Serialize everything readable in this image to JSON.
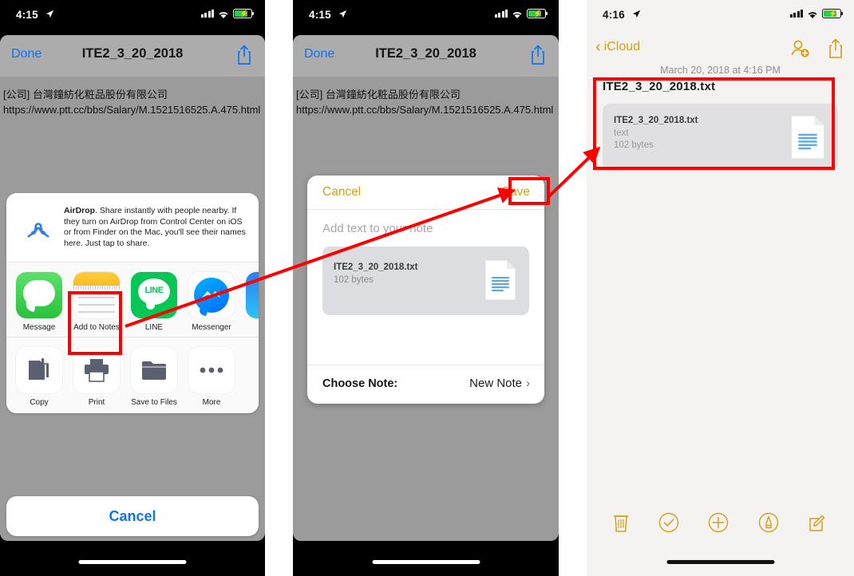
{
  "panels": [
    {
      "id": "share-sheet",
      "statusbar": {
        "time": "4:15",
        "location_icon": "location-arrow-icon",
        "signal": "cellular-bars-icon",
        "wifi": "wifi-icon",
        "battery": "battery-charging-icon"
      },
      "navbar": {
        "done": "Done",
        "title": "ITE2_3_20_2018",
        "share_icon": "share-icon"
      },
      "document": {
        "line1": "[公司] 台灣鐘紡化粧品股份有限公司",
        "line2": "https://www.ptt.cc/bbs/Salary/M.1521516525.A.475.html"
      },
      "airdrop": {
        "icon": "airdrop-icon",
        "bold": "AirDrop",
        "text": ". Share instantly with people nearby. If they turn on AirDrop from Control Center on iOS or from Finder on the Mac, you'll see their names here. Just tap to share."
      },
      "apps": [
        {
          "label": "Message",
          "icon": "messages-app-icon"
        },
        {
          "label": "Add to Notes",
          "icon": "notes-app-icon",
          "highlighted": true
        },
        {
          "label": "LINE",
          "icon": "line-app-icon"
        },
        {
          "label": "Messenger",
          "icon": "messenger-app-icon"
        },
        {
          "label": "",
          "icon": "telegram-app-icon"
        }
      ],
      "actions": [
        {
          "label": "Copy",
          "icon": "copy-icon"
        },
        {
          "label": "Print",
          "icon": "printer-icon"
        },
        {
          "label": "Save to Files",
          "icon": "folder-icon"
        },
        {
          "label": "More",
          "icon": "more-ellipsis-icon"
        }
      ],
      "cancel": "Cancel"
    },
    {
      "id": "add-to-notes",
      "statusbar": {
        "time": "4:15"
      },
      "navbar": {
        "done": "Done",
        "title": "ITE2_3_20_2018",
        "share_icon": "share-icon"
      },
      "document": {
        "line1": "[公司] 台灣鐘紡化粧品股份有限公司",
        "line2": "https://www.ptt.cc/bbs/Salary/M.1521516525.A.475.html"
      },
      "notes_sheet": {
        "cancel": "Cancel",
        "save": "Save",
        "placeholder": "Add text to your note",
        "attachment": {
          "name": "ITE2_3_20_2018.txt",
          "size": "102 bytes",
          "icon": "text-file-icon"
        },
        "choose_label": "Choose Note:",
        "choose_value": "New Note",
        "chevron": "chevron-right-icon"
      }
    },
    {
      "id": "notes-saved",
      "statusbar": {
        "time": "4:16"
      },
      "navbar": {
        "back": "iCloud",
        "back_icon": "chevron-left-icon",
        "add_people_icon": "add-person-icon",
        "share_icon": "share-icon"
      },
      "date": "March 20, 2018 at 4:16 PM",
      "note": {
        "title": "ITE2_3_20_2018.txt",
        "attachment": {
          "name": "ITE2_3_20_2018.txt",
          "type": "text",
          "size": "102 bytes",
          "icon": "text-file-icon"
        }
      },
      "toolbar": [
        {
          "icon": "trash-icon"
        },
        {
          "icon": "checkmark-circle-icon"
        },
        {
          "icon": "plus-circle-icon"
        },
        {
          "icon": "markup-pen-icon"
        },
        {
          "icon": "compose-icon"
        }
      ]
    }
  ],
  "annotations": {
    "accent": "#ff0000",
    "highlight_boxes": [
      "add-to-notes-app-icon",
      "save-button",
      "saved-note-card"
    ],
    "arrows": [
      "notes-icon-to-save-button",
      "save-button-to-saved-note"
    ]
  },
  "colors": {
    "ios_blue": "#0b74ff",
    "notes_yellow": "#d4a017",
    "sheet_gray": "#9b9b9b",
    "red": "#ff0000"
  }
}
